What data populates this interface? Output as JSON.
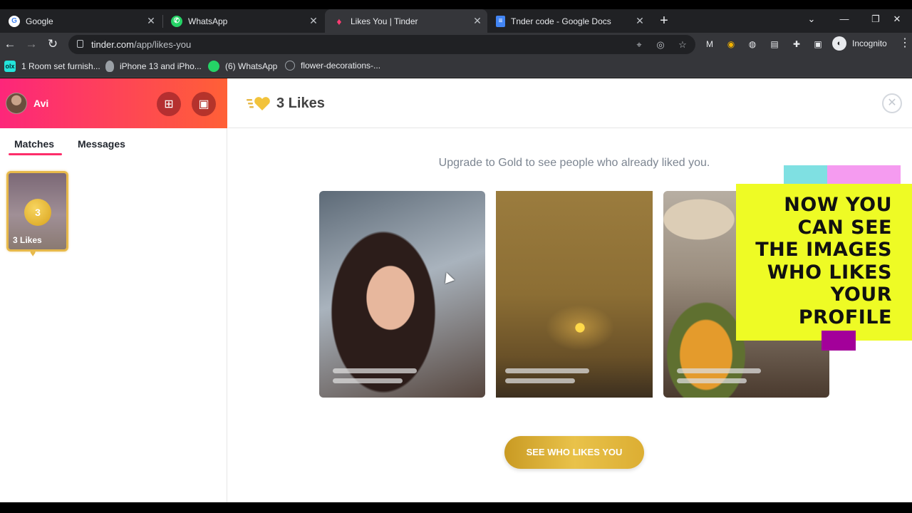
{
  "browser": {
    "tabs": [
      {
        "label": "Google",
        "icon": "google-icon",
        "close": "✕"
      },
      {
        "label": "WhatsApp",
        "icon": "whatsapp-icon",
        "close": "✕"
      },
      {
        "label": "Likes You | Tinder",
        "icon": "tinder-flame-icon",
        "close": "✕"
      },
      {
        "label": "Tnder code - Google Docs",
        "icon": "google-docs-icon",
        "close": "✕"
      }
    ],
    "new_tab": "+",
    "window_controls": {
      "tabsearch": "⌄",
      "minimize": "—",
      "restore": "❐",
      "close": "✕"
    },
    "nav": {
      "back": "←",
      "forward": "→",
      "reload": "↻"
    },
    "url_domain": "tinder.com",
    "url_path": "/app/likes-you",
    "omnibox_icons": {
      "location": "⌖",
      "eye": "◎",
      "star": "☆"
    },
    "extensions": [
      "M",
      "◉",
      "◍",
      "▤",
      "✚",
      "▣"
    ],
    "profile": {
      "avatar": "◐",
      "label": "Incognito"
    },
    "menu": "⋮",
    "bookmarks": [
      {
        "label": "1 Room set furnish...",
        "icon": "olx-icon",
        "icon_text": "olx"
      },
      {
        "label": "iPhone 13 and iPho...",
        "icon": "apple-icon",
        "icon_text": ""
      },
      {
        "label": "(6) WhatsApp",
        "icon": "whatsapp-icon",
        "icon_text": ""
      },
      {
        "label": "flower-decorations-...",
        "icon": "globe-icon",
        "icon_text": ""
      }
    ]
  },
  "sidebar": {
    "user_name": "Avi",
    "explore_icon": "⊞",
    "work_icon": "▣",
    "tabs": [
      "Matches",
      "Messages"
    ],
    "likes_card": {
      "count": "3",
      "label": "3 Likes"
    }
  },
  "main": {
    "title": "3 Likes",
    "close": "✕",
    "upgrade_text": "Upgrade to Gold to see people who already liked you.",
    "cta": "SEE WHO LIKES YOU"
  },
  "overlay": {
    "lines": [
      "NOW YOU",
      "CAN SEE",
      "THE IMAGES",
      "WHO LIKES",
      "YOUR",
      "PROFILE"
    ]
  },
  "colors": {
    "tinder_gradient_start": "#fd267a",
    "tinder_gradient_end": "#ff6036",
    "gold": "#e7b94a",
    "sticky_yellow": "#eefb25"
  }
}
